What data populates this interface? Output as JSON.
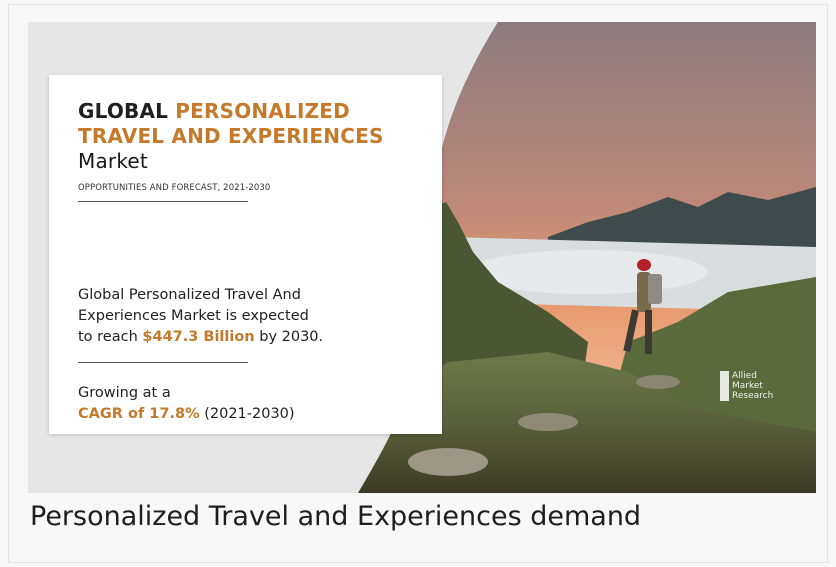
{
  "banner": {
    "title_plain": "GLOBAL ",
    "title_accent_1": "PERSONALIZED",
    "title_accent_2": "TRAVEL AND EXPERIENCES",
    "title_market": "Market",
    "subtitle": "OPPORTUNITIES AND FORECAST, 2021-2030",
    "body_line_1": "Global Personalized Travel And",
    "body_line_2": "Experiences Market is expected",
    "body_line_3_prefix": "to reach ",
    "body_value": "$447.3 Billion",
    "body_line_3_suffix": " by 2030.",
    "growth_line_1": "Growing at a",
    "growth_cagr": "CAGR of 17.8%",
    "growth_period": " (2021-2030)",
    "logo_lines": [
      "Allied",
      "Market",
      "Research"
    ]
  },
  "caption": "Personalized Travel and Experiences demand",
  "colors": {
    "accent": "#c47a2a",
    "banner_bg": "#e6e6e6",
    "card_bg": "#ffffff"
  }
}
